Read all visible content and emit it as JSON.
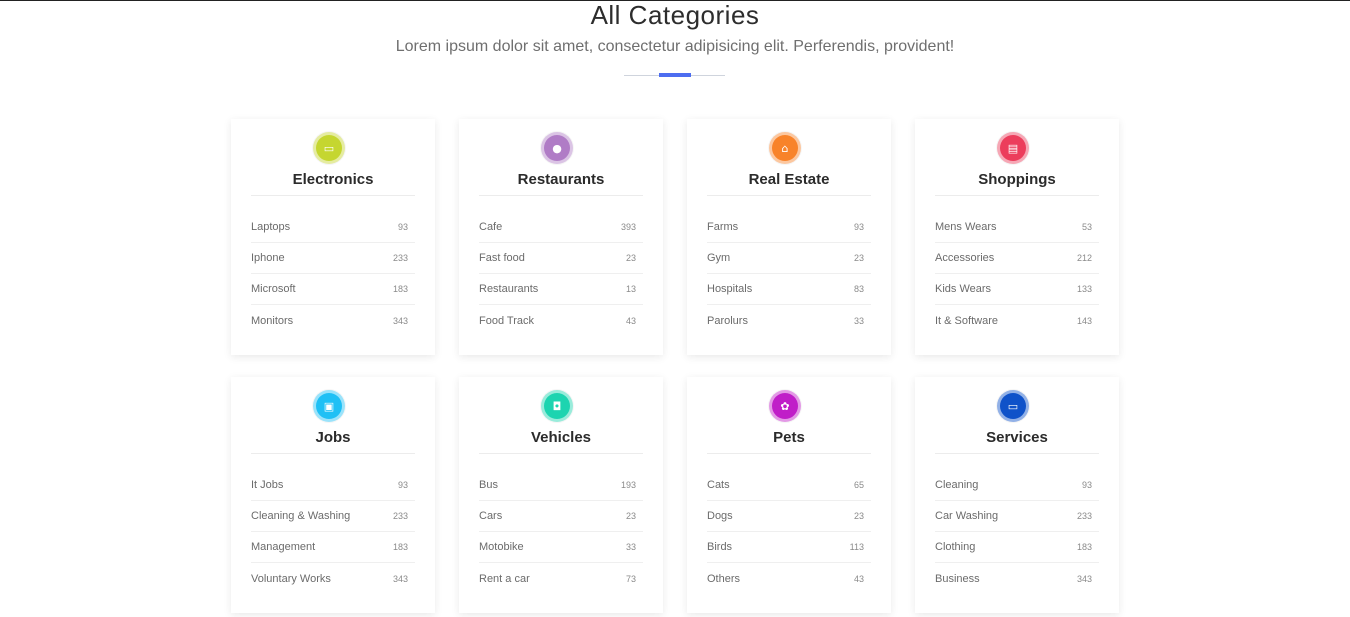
{
  "header": {
    "title": "All Categories",
    "subtitle": "Lorem ipsum dolor sit amet, consectetur adipisicing elit. Perferendis, provident!"
  },
  "accent_color": "#4d6df0",
  "categories": [
    {
      "name": "electronics",
      "title": "Electronics",
      "icon": "laptop-icon",
      "glyph": "▭",
      "color": "#c5d630",
      "items": [
        {
          "label": "Laptops",
          "count": "93"
        },
        {
          "label": "Iphone",
          "count": "233"
        },
        {
          "label": "Microsoft",
          "count": "183"
        },
        {
          "label": "Monitors",
          "count": "343"
        }
      ]
    },
    {
      "name": "restaurants",
      "title": "Restaurants",
      "icon": "apple-icon",
      "glyph": "●",
      "color": "#b07cc6",
      "items": [
        {
          "label": "Cafe",
          "count": "393"
        },
        {
          "label": "Fast food",
          "count": "23"
        },
        {
          "label": "Restaurants",
          "count": "13"
        },
        {
          "label": "Food Track",
          "count": "43"
        }
      ]
    },
    {
      "name": "real-estate",
      "title": "Real Estate",
      "icon": "home-icon",
      "glyph": "⌂",
      "color": "#f8832a",
      "items": [
        {
          "label": "Farms",
          "count": "93"
        },
        {
          "label": "Gym",
          "count": "23"
        },
        {
          "label": "Hospitals",
          "count": "83"
        },
        {
          "label": "Parolurs",
          "count": "33"
        }
      ]
    },
    {
      "name": "shoppings",
      "title": "Shoppings",
      "icon": "shopping-basket-icon",
      "glyph": "▤",
      "color": "#ec3d5c",
      "items": [
        {
          "label": "Mens Wears",
          "count": "53"
        },
        {
          "label": "Accessories",
          "count": "212"
        },
        {
          "label": "Kids Wears",
          "count": "133"
        },
        {
          "label": "It & Software",
          "count": "143"
        }
      ]
    },
    {
      "name": "jobs",
      "title": "Jobs",
      "icon": "briefcase-icon",
      "glyph": "▣",
      "color": "#1fc0f5",
      "items": [
        {
          "label": "It Jobs",
          "count": "93"
        },
        {
          "label": "Cleaning & Washing",
          "count": "233"
        },
        {
          "label": "Management",
          "count": "183"
        },
        {
          "label": "Voluntary Works",
          "count": "343"
        }
      ]
    },
    {
      "name": "vehicles",
      "title": "Vehicles",
      "icon": "car-icon",
      "glyph": "◘",
      "color": "#1dd4b0",
      "items": [
        {
          "label": "Bus",
          "count": "193"
        },
        {
          "label": "Cars",
          "count": "23"
        },
        {
          "label": "Motobike",
          "count": "33"
        },
        {
          "label": "Rent a car",
          "count": "73"
        }
      ]
    },
    {
      "name": "pets",
      "title": "Pets",
      "icon": "paw-icon",
      "glyph": "✿",
      "color": "#c01ec8",
      "items": [
        {
          "label": "Cats",
          "count": "65"
        },
        {
          "label": "Dogs",
          "count": "23"
        },
        {
          "label": "Birds",
          "count": "113"
        },
        {
          "label": "Others",
          "count": "43"
        }
      ]
    },
    {
      "name": "services",
      "title": "Services",
      "icon": "laptop-icon",
      "glyph": "▭",
      "color": "#0f52c9",
      "items": [
        {
          "label": "Cleaning",
          "count": "93"
        },
        {
          "label": "Car Washing",
          "count": "233"
        },
        {
          "label": "Clothing",
          "count": "183"
        },
        {
          "label": "Business",
          "count": "343"
        }
      ]
    }
  ]
}
